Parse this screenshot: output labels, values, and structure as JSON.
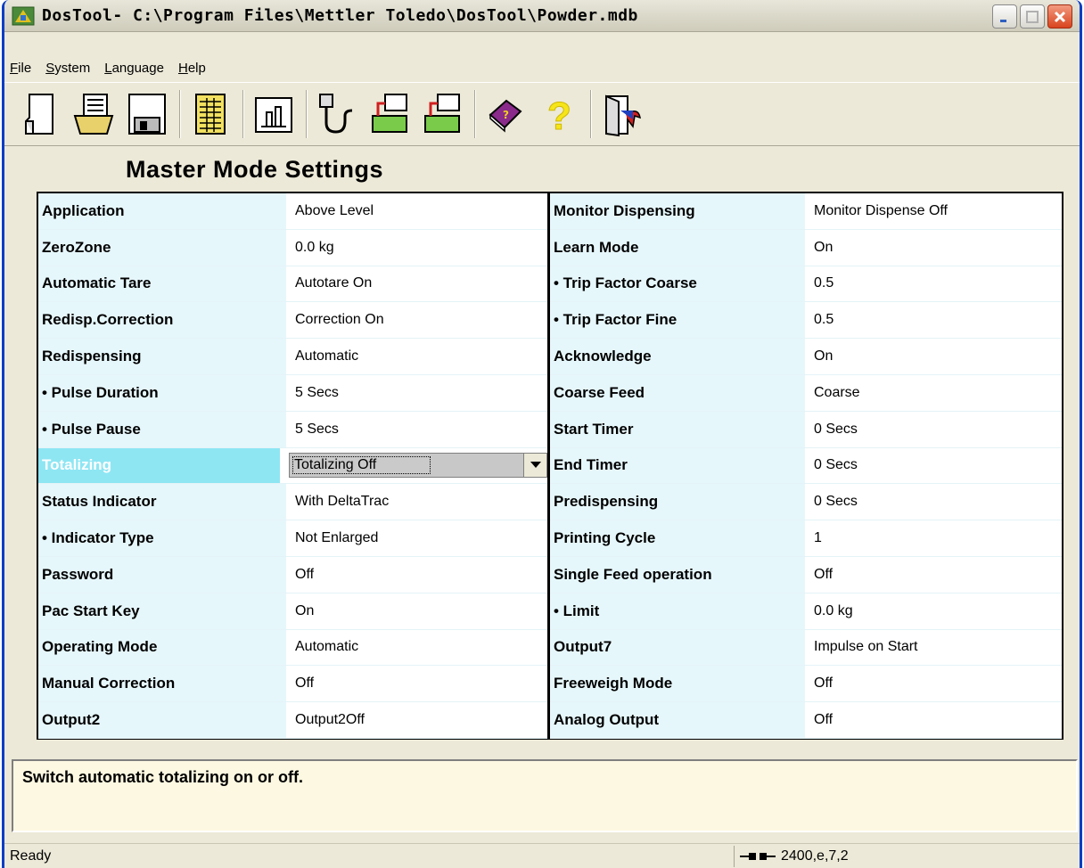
{
  "window": {
    "title": "DosTool- C:\\Program Files\\Mettler Toledo\\DosTool\\Powder.mdb"
  },
  "menu": [
    "File",
    "System",
    "Language",
    "Help"
  ],
  "toolbar": {
    "icons": [
      "new-document-icon",
      "open-folder-icon",
      "save-disk-icon",
      "spreadsheet-icon",
      "scale-icon",
      "cable-connection-icon",
      "upload-to-device-icon",
      "download-from-device-icon",
      "help-book-icon",
      "question-mark-icon",
      "exit-door-icon"
    ]
  },
  "page_title": "Master Mode Settings",
  "settings": {
    "left": [
      {
        "label": "Application",
        "value": "Above Level"
      },
      {
        "label": "ZeroZone",
        "value": "0.0 kg"
      },
      {
        "label": "Automatic Tare",
        "value": "Autotare On"
      },
      {
        "label": "Redisp.Correction",
        "value": "Correction On"
      },
      {
        "label": "Redispensing",
        "value": "Automatic"
      },
      {
        "label": "• Pulse Duration",
        "value": "5 Secs"
      },
      {
        "label": "• Pulse Pause",
        "value": "5 Secs"
      },
      {
        "label": "Totalizing",
        "value": "Totalizing Off",
        "selected": true
      },
      {
        "label": "Status Indicator",
        "value": "With DeltaTrac"
      },
      {
        "label": "• Indicator Type",
        "value": "Not Enlarged"
      },
      {
        "label": "Password",
        "value": "Off"
      },
      {
        "label": "Pac Start Key",
        "value": "On"
      },
      {
        "label": "Operating Mode",
        "value": "Automatic"
      },
      {
        "label": "Manual Correction",
        "value": "Off"
      },
      {
        "label": "Output2",
        "value": "Output2Off"
      }
    ],
    "right": [
      {
        "label": "Monitor Dispensing",
        "value": "Monitor Dispense Off"
      },
      {
        "label": "Learn Mode",
        "value": "On"
      },
      {
        "label": "• Trip Factor Coarse",
        "value": "0.5"
      },
      {
        "label": "• Trip Factor Fine",
        "value": "0.5"
      },
      {
        "label": "Acknowledge",
        "value": "On"
      },
      {
        "label": "Coarse Feed",
        "value": "Coarse"
      },
      {
        "label": "Start Timer",
        "value": "0 Secs"
      },
      {
        "label": "End Timer",
        "value": "0 Secs"
      },
      {
        "label": "Predispensing",
        "value": "0 Secs"
      },
      {
        "label": "Printing Cycle",
        "value": "1"
      },
      {
        "label": "Single Feed operation",
        "value": "Off"
      },
      {
        "label": "• Limit",
        "value": "0.0 kg"
      },
      {
        "label": "Output7",
        "value": "Impulse on Start"
      },
      {
        "label": "Freeweigh Mode",
        "value": "Off"
      },
      {
        "label": "Analog Output",
        "value": "Off"
      }
    ]
  },
  "help_text": "Switch automatic totalizing on or off.",
  "status": {
    "text": "Ready",
    "port": "2400,e,7,2",
    "port_icon": "serial-connector-icon"
  },
  "colors": {
    "label_bg": "#e6f7fb",
    "selected_label_bg": "#8ee6f3",
    "help_bg": "#fdf8e1",
    "window_border": "#0a3ec5"
  }
}
